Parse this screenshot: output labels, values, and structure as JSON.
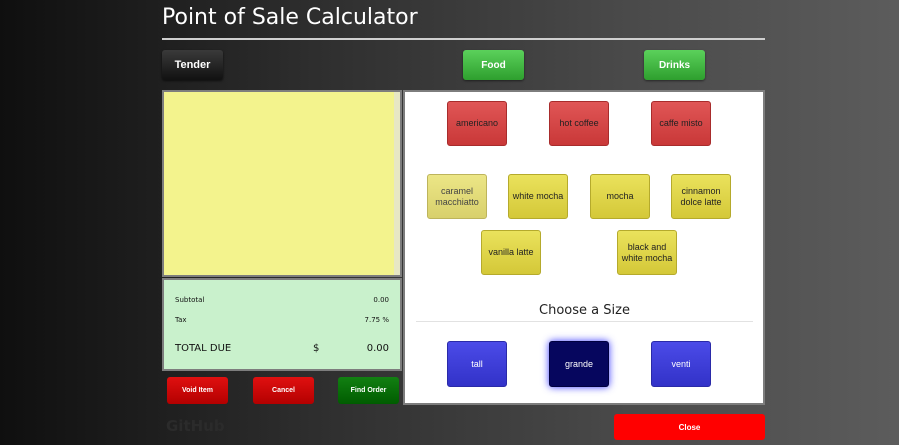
{
  "header": {
    "title": "Point of Sale Calculator"
  },
  "toolbar": {
    "tender": "Tender",
    "food": "Food",
    "drinks": "Drinks"
  },
  "totals": {
    "subtotal_label": "Subtotal",
    "subtotal_value": "0.00",
    "tax_label": "Tax",
    "tax_value": "7.75 %",
    "total_label": "TOTAL DUE",
    "currency": "$",
    "total_value": "0.00"
  },
  "actions": {
    "void": "Void Item",
    "cancel": "Cancel",
    "find": "Find Order"
  },
  "footer": {
    "github": "GitHub",
    "close": "Close"
  },
  "menu": {
    "items": [
      {
        "label": "americano",
        "color": "#d94848"
      },
      {
        "label": "hot coffee",
        "color": "#d94848"
      },
      {
        "label": "caffe misto",
        "color": "#d94848"
      },
      {
        "label": "caramel macchiatto",
        "color": "#e0da78"
      },
      {
        "label": "white mocha",
        "color": "#e0d64a"
      },
      {
        "label": "mocha",
        "color": "#e0d64a"
      },
      {
        "label": "cinnamon dolce latte",
        "color": "#e0d64a"
      },
      {
        "label": "vanilla latte",
        "color": "#e0d64a"
      },
      {
        "label": "black and white mocha",
        "color": "#e0d64a"
      }
    ]
  },
  "size": {
    "heading": "Choose a Size",
    "options": [
      {
        "label": "tall",
        "color": "#4040dd"
      },
      {
        "label": "grande",
        "color": "#06065e"
      },
      {
        "label": "venti",
        "color": "#4040dd"
      }
    ],
    "selected": "grande"
  }
}
